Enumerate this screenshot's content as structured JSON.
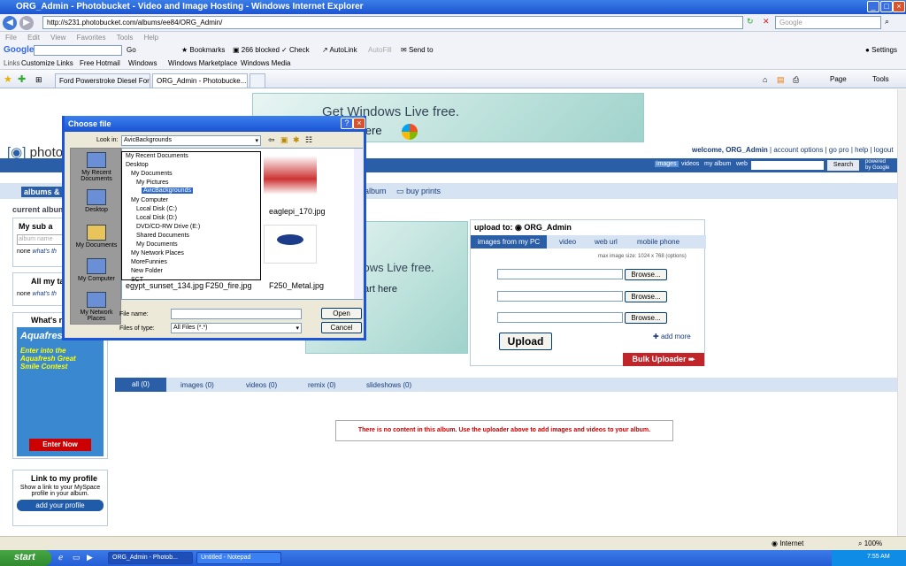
{
  "window": {
    "title": "ORG_Admin - Photobucket - Video and Image Hosting - Windows Internet Explorer",
    "url": "http://s231.photobucket.com/albums/ee84/ORG_Admin/",
    "search_placeholder": "Google"
  },
  "menu": [
    "File",
    "Edit",
    "View",
    "Favorites",
    "Tools",
    "Help"
  ],
  "googlebar": {
    "brand": "Google",
    "go": "Go",
    "bookmarks": "Bookmarks",
    "blocked": "266 blocked",
    "check": "Check",
    "autolink": "AutoLink",
    "autofill": "AutoFill",
    "sendto": "Send to",
    "settings": "Settings"
  },
  "links": {
    "label": "Links",
    "items": [
      "Customize Links",
      "Free Hotmail",
      "Windows",
      "Windows Marketplace",
      "Windows Media"
    ]
  },
  "tabs": [
    "Ford Powerstroke Diesel Forum",
    "ORG_Admin - Photobucke..."
  ],
  "toolbar_right": {
    "page": "Page",
    "tools": "Tools"
  },
  "ad_top": {
    "line1": "Get Windows Live free.",
    "line2": "rt here"
  },
  "site": {
    "logo": "photob",
    "welcome": "welcome, ORG_Admin",
    "links": [
      "account options",
      "go pro",
      "help",
      "logout"
    ],
    "search_tabs": [
      "images",
      "videos",
      "my album",
      "web"
    ],
    "search_button": "Search",
    "powered": "powered by Google"
  },
  "albumbar": {
    "title": "albums & u",
    "album": "album",
    "buy_prints": "buy prints"
  },
  "left": {
    "current_album": "current album",
    "my_sub": "My sub a",
    "album_name": "album name",
    "none1": "none",
    "whats1": "what's th",
    "my_ta": "All my ta",
    "none2": "none",
    "whats2": "what's th",
    "whats_new": "What's n",
    "aquafresh": "Aquafresh",
    "contest": "Enter into the Aquafresh Great Smile Contest",
    "enter_now": "Enter Now",
    "link_profile_title": "Link to my profile",
    "link_profile_desc": "Show a link to your MySpace profile in your album.",
    "add_profile": "add your profile"
  },
  "ad_mid": {
    "line1": "ndows Live free.",
    "line2": "tart here"
  },
  "upload": {
    "title": "upload to:",
    "target": "ORG_Admin",
    "tabs": [
      "images from my PC",
      "video",
      "web url",
      "mobile phone"
    ],
    "max_size": "max image size: 1024 x 768 (options)",
    "browse": "Browse...",
    "button": "Upload",
    "add_more": "add more",
    "bulk": "Bulk Uploader"
  },
  "filter_tabs": [
    "all (0)",
    "images (0)",
    "videos (0)",
    "remix (0)",
    "slideshows (0)"
  ],
  "empty_msg": "There is no content in this album. Use the uploader above to add images and videos to your album.",
  "dialog": {
    "title": "Choose file",
    "look_in_label": "Look in:",
    "look_in_value": "AvicBackgrounds",
    "places": [
      "My Recent Documents",
      "Desktop",
      "My Documents",
      "My Computer",
      "My Network Places"
    ],
    "dropdown": [
      "My Recent Documents",
      "Desktop",
      "My Documents",
      "My Pictures",
      "AvicBackgrounds",
      "My Computer",
      "Local Disk (C:)",
      "Local Disk (D:)",
      "DVD/CD-RW Drive (E:)",
      "Shared Documents",
      "My Documents",
      "My Network Places",
      "MoreFunnies",
      "New Folder",
      "SCT"
    ],
    "files": [
      "eaglepi_170.jpg",
      "egypt_sunset_134.jpg",
      "F250_fire.jpg",
      "F250_Metal.jpg"
    ],
    "file_name_label": "File name:",
    "file_type_label": "Files of type:",
    "file_type_value": "All Files (*.*)",
    "open": "Open",
    "cancel": "Cancel"
  },
  "status": {
    "zone": "Internet",
    "zoom": "100%"
  },
  "taskbar": {
    "start": "start",
    "tasks": [
      "ORG_Admin - Photob...",
      "Untitled - Notepad"
    ],
    "time": "7:55 AM"
  }
}
